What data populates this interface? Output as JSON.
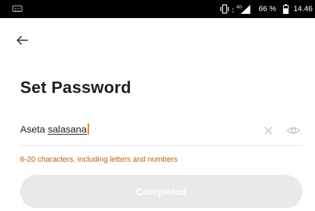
{
  "status_bar": {
    "network": "4G",
    "battery": "66 %",
    "time": "14.46",
    "icons": [
      "keyboard-icon",
      "vibrate-icon",
      "signal-icon",
      "battery-icon"
    ]
  },
  "header": {
    "back_icon": "arrow-left-icon"
  },
  "page": {
    "title": "Set Password"
  },
  "password_field": {
    "value_part1": "Aseta ",
    "value_part2": "salasana",
    "clear_icon": "close-icon",
    "visibility_icon": "eye-icon"
  },
  "hint": {
    "text": "6-20 characters, including letters and numbers",
    "color": "#d35d00"
  },
  "completed_button": {
    "label": "Completed",
    "enabled": false,
    "background": "#e9e9e9"
  },
  "colors": {
    "caret": "#e8821f",
    "divider": "#e4e4e4"
  }
}
